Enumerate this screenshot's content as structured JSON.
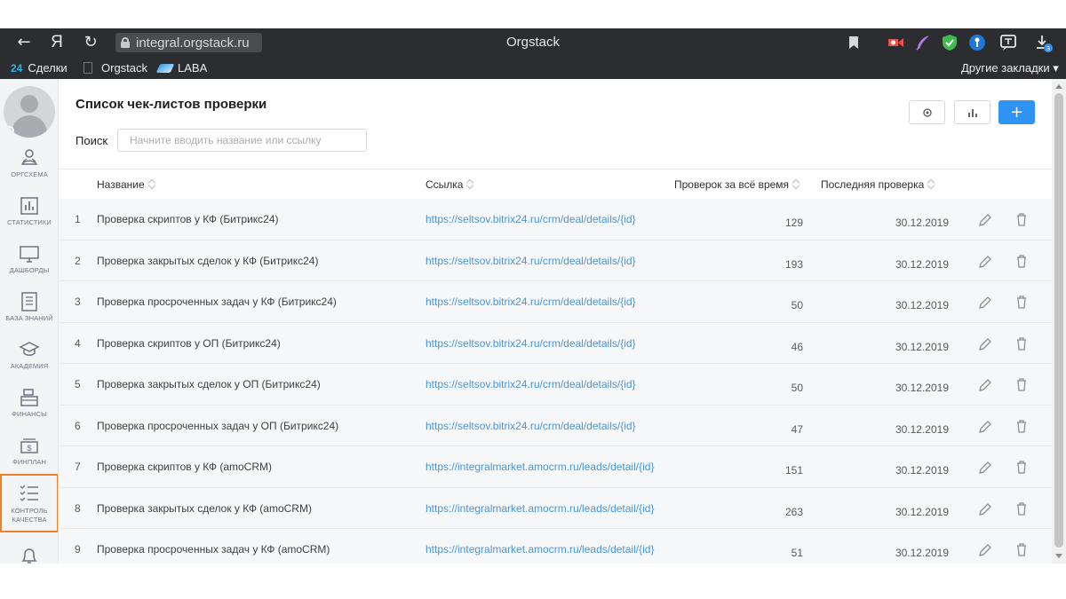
{
  "browser": {
    "window_title": "Orgstack",
    "url": "integral.orgstack.ru",
    "nav": {
      "back": "←",
      "yandex": "Я",
      "reload": "↻"
    },
    "download_badge": "3",
    "bookmarks": [
      {
        "label": "Сделки",
        "prefix": "24"
      },
      {
        "label": "Orgstack"
      },
      {
        "label": "LABA"
      }
    ],
    "other_bookmarks": "Другие закладки ▾"
  },
  "sidebar": {
    "items": [
      {
        "label": "ОРГСХЕМА",
        "icon": "orgchart-icon"
      },
      {
        "label": "СТАТИСТИКИ",
        "icon": "statistics-icon"
      },
      {
        "label": "ДАШБОРДЫ",
        "icon": "monitor-icon"
      },
      {
        "label": "БАЗА ЗНАНИЙ",
        "icon": "document-icon"
      },
      {
        "label": "АКАДЕМИЯ",
        "icon": "graduation-cap-icon"
      },
      {
        "label": "ФИНАНСЫ",
        "icon": "cash-register-icon"
      },
      {
        "label": "ФИНПЛАН",
        "icon": "money-icon"
      },
      {
        "label": "КОНТРОЛЬ КАЧЕСТВА",
        "icon": "checklist-icon",
        "active": true
      },
      {
        "label": "",
        "icon": "bell-icon"
      }
    ]
  },
  "page": {
    "title": "Список чек-листов проверки",
    "search_label": "Поиск",
    "search_placeholder": "Начните вводить название или ссылку",
    "search_value": ""
  },
  "table": {
    "columns": {
      "name": "Название",
      "link": "Ссылка",
      "count": "Проверок за всё время",
      "last": "Последняя проверка"
    },
    "rows": [
      {
        "num": "1",
        "name": "Проверка скриптов у КФ (Битрикс24)",
        "link": "https://seltsov.bitrix24.ru/crm/deal/details/{id}",
        "count": "129",
        "date": "30.12.2019"
      },
      {
        "num": "2",
        "name": "Проверка закрытых сделок у КФ (Битрикс24)",
        "link": "https://seltsov.bitrix24.ru/crm/deal/details/{id}",
        "count": "193",
        "date": "30.12.2019"
      },
      {
        "num": "3",
        "name": "Проверка просроченных задач у КФ (Битрикс24)",
        "link": "https://seltsov.bitrix24.ru/crm/deal/details/{id}",
        "count": "50",
        "date": "30.12.2019"
      },
      {
        "num": "4",
        "name": "Проверка скриптов у ОП (Битрикс24)",
        "link": "https://seltsov.bitrix24.ru/crm/deal/details/{id}",
        "count": "46",
        "date": "30.12.2019"
      },
      {
        "num": "5",
        "name": "Проверка закрытых сделок у ОП (Битрикс24)",
        "link": "https://seltsov.bitrix24.ru/crm/deal/details/{id}",
        "count": "50",
        "date": "30.12.2019"
      },
      {
        "num": "6",
        "name": "Проверка просроченных задач у ОП (Битрикс24)",
        "link": "https://seltsov.bitrix24.ru/crm/deal/details/{id}",
        "count": "47",
        "date": "30.12.2019"
      },
      {
        "num": "7",
        "name": "Проверка скриптов у КФ (amoCRM)",
        "link": "https://integralmarket.amocrm.ru/leads/detail/{id}",
        "count": "151",
        "date": "30.12.2019"
      },
      {
        "num": "8",
        "name": "Проверка закрытых сделок у КФ (amoCRM)",
        "link": "https://integralmarket.amocrm.ru/leads/detail/{id}",
        "count": "263",
        "date": "30.12.2019"
      },
      {
        "num": "9",
        "name": "Проверка просроченных задач у КФ (amoCRM)",
        "link": "https://integralmarket.amocrm.ru/leads/detail/{id}",
        "count": "51",
        "date": "30.12.2019"
      }
    ]
  },
  "colors": {
    "accent": "#2e93f2",
    "active_outline": "#f07f26",
    "link": "#4a96d6",
    "chrome": "#2b2d31"
  }
}
